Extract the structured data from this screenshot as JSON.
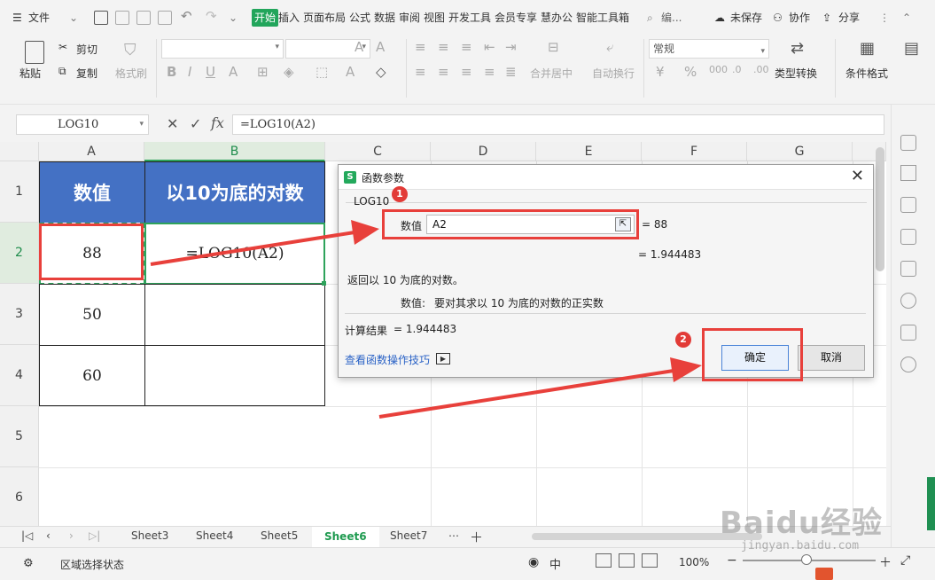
{
  "menubar": {
    "file": "文件",
    "start": "开始",
    "tabs": [
      "插入",
      "页面布局",
      "公式",
      "数据",
      "审阅",
      "视图",
      "开发工具",
      "会员专享",
      "慧办公",
      "智能工具箱"
    ],
    "search": "编...",
    "unsaved": "未保存",
    "collab": "协作",
    "share": "分享"
  },
  "ribbon": {
    "paste": "粘贴",
    "cut": "剪切",
    "copy": "复制",
    "format_painter": "格式刷",
    "merge": "合并居中",
    "wrap": "自动换行",
    "number_format": "常规",
    "type_convert": "类型转换",
    "cond_format": "条件格式"
  },
  "formula_bar": {
    "name_box": "LOG10",
    "formula": "=LOG10(A2)",
    "fx": "fx"
  },
  "grid": {
    "columns": [
      "A",
      "B",
      "C",
      "D",
      "E",
      "F",
      "G"
    ],
    "rows": [
      "1",
      "2",
      "3",
      "4",
      "5",
      "6"
    ],
    "header_a": "数值",
    "header_b": "以10为底的对数",
    "cells_a": [
      "88",
      "50",
      "60"
    ],
    "cell_b2": "=LOG10(A2)"
  },
  "sheets": {
    "tabs": [
      "Sheet3",
      "Sheet4",
      "Sheet5",
      "Sheet6",
      "Sheet7"
    ],
    "active": "Sheet6"
  },
  "status": {
    "mode": "区域选择状态",
    "zoom": "100%"
  },
  "dialog": {
    "title": "函数参数",
    "function_name": "LOG10",
    "arg_label": "数值",
    "arg_value": "A2",
    "arg_result": "= 88",
    "fn_result": "= 1.944483",
    "description": "返回以 10 为底的对数。",
    "arg_desc_label": "数值:",
    "arg_desc": "要对其求以 10 为底的对数的正实数",
    "calc_label": "计算结果",
    "calc_value": "= 1.944483",
    "help_link": "查看函数操作技巧",
    "ok": "确定",
    "cancel": "取消"
  },
  "annotations": {
    "badge1": "1",
    "badge2": "2"
  },
  "watermark": {
    "brand": "Baidu经验",
    "url": "jingyan.baidu.com"
  },
  "colors": {
    "accent_green": "#22a55b",
    "header_blue": "#4471c4",
    "annotation_red": "#e8403b"
  }
}
